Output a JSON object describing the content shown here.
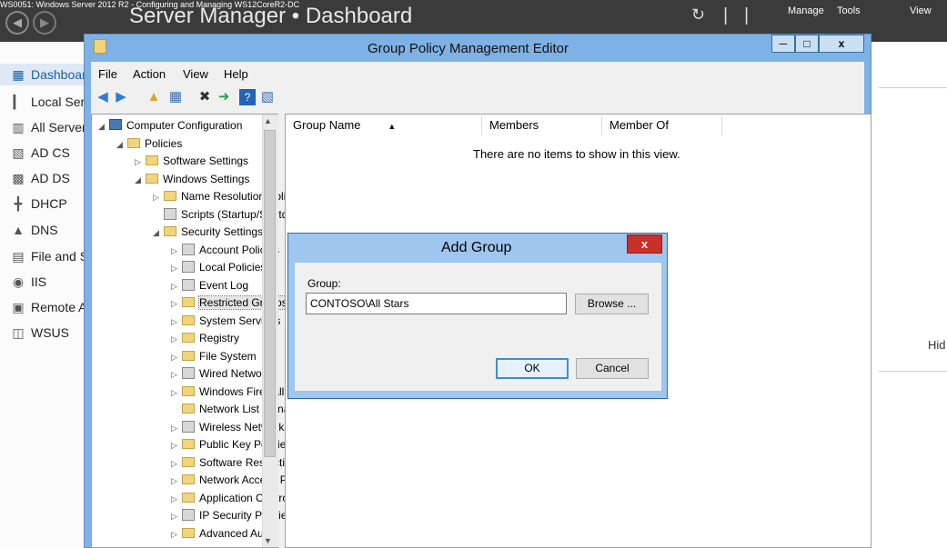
{
  "server_manager": {
    "caption": "WS0051: Windows Server 2012 R2 - Configuring and Managing    WS12CoreR2-DC",
    "breadcrumb": "Server Manager • Dashboard",
    "menu": {
      "manage": "Manage",
      "tools": "Tools",
      "view": "View"
    },
    "nav": [
      {
        "label": "Dashboard",
        "icon": "dashboard-icon"
      },
      {
        "label": "Local Server",
        "icon": "server-icon"
      },
      {
        "label": "All Servers",
        "icon": "servers-icon"
      },
      {
        "label": "AD CS",
        "icon": "adcs-icon"
      },
      {
        "label": "AD DS",
        "icon": "adds-icon"
      },
      {
        "label": "DHCP",
        "icon": "dhcp-icon"
      },
      {
        "label": "DNS",
        "icon": "dns-icon"
      },
      {
        "label": "File and Storage Services",
        "icon": "file-icon"
      },
      {
        "label": "IIS",
        "icon": "iis-icon"
      },
      {
        "label": "Remote Access",
        "icon": "remote-icon"
      },
      {
        "label": "WSUS",
        "icon": "wsus-icon"
      }
    ],
    "hide_label": "Hid"
  },
  "gpme": {
    "title": "Group Policy Management Editor",
    "menubar": [
      "File",
      "Action",
      "View",
      "Help"
    ],
    "tree": [
      {
        "label": "Computer Configuration",
        "depth": 0,
        "expanded": true,
        "icon": "computer"
      },
      {
        "label": "Policies",
        "depth": 1,
        "expanded": true,
        "icon": "folder"
      },
      {
        "label": "Software Settings",
        "depth": 2,
        "expanded": false,
        "icon": "folder"
      },
      {
        "label": "Windows Settings",
        "depth": 2,
        "expanded": true,
        "icon": "folder"
      },
      {
        "label": "Name Resolution Policy",
        "depth": 3,
        "expanded": false,
        "icon": "folder"
      },
      {
        "label": "Scripts (Startup/Shutdown)",
        "depth": 3,
        "expanded": null,
        "icon": "script"
      },
      {
        "label": "Security Settings",
        "depth": 3,
        "expanded": true,
        "icon": "secfolder"
      },
      {
        "label": "Account Policies",
        "depth": 4,
        "expanded": false,
        "icon": "doc"
      },
      {
        "label": "Local Policies",
        "depth": 4,
        "expanded": false,
        "icon": "doc"
      },
      {
        "label": "Event Log",
        "depth": 4,
        "expanded": false,
        "icon": "doc"
      },
      {
        "label": "Restricted Groups",
        "depth": 4,
        "expanded": false,
        "icon": "secfolder",
        "selected": true
      },
      {
        "label": "System Services",
        "depth": 4,
        "expanded": false,
        "icon": "secfolder"
      },
      {
        "label": "Registry",
        "depth": 4,
        "expanded": false,
        "icon": "secfolder"
      },
      {
        "label": "File System",
        "depth": 4,
        "expanded": false,
        "icon": "secfolder"
      },
      {
        "label": "Wired Network",
        "depth": 4,
        "expanded": false,
        "icon": "doc"
      },
      {
        "label": "Windows Firewall",
        "depth": 4,
        "expanded": false,
        "icon": "folder"
      },
      {
        "label": "Network List Manager",
        "depth": 4,
        "expanded": null,
        "icon": "folder"
      },
      {
        "label": "Wireless Network",
        "depth": 4,
        "expanded": false,
        "icon": "doc"
      },
      {
        "label": "Public Key Policies",
        "depth": 4,
        "expanded": false,
        "icon": "folder"
      },
      {
        "label": "Software Restriction",
        "depth": 4,
        "expanded": false,
        "icon": "folder"
      },
      {
        "label": "Network Access Protection",
        "depth": 4,
        "expanded": false,
        "icon": "folder"
      },
      {
        "label": "Application Control",
        "depth": 4,
        "expanded": false,
        "icon": "folder"
      },
      {
        "label": "IP Security Policies",
        "depth": 4,
        "expanded": false,
        "icon": "ipsec"
      },
      {
        "label": "Advanced Audit",
        "depth": 4,
        "expanded": false,
        "icon": "folder"
      }
    ],
    "list": {
      "columns": [
        "Group Name",
        "Members",
        "Member Of"
      ],
      "empty_message": "There are no items to show in this view."
    }
  },
  "dialog": {
    "title": "Add Group",
    "group_label": "Group:",
    "group_value": "CONTOSO\\All Stars",
    "browse_label": "Browse ...",
    "ok_label": "OK",
    "cancel_label": "Cancel",
    "close_glyph": "x"
  }
}
